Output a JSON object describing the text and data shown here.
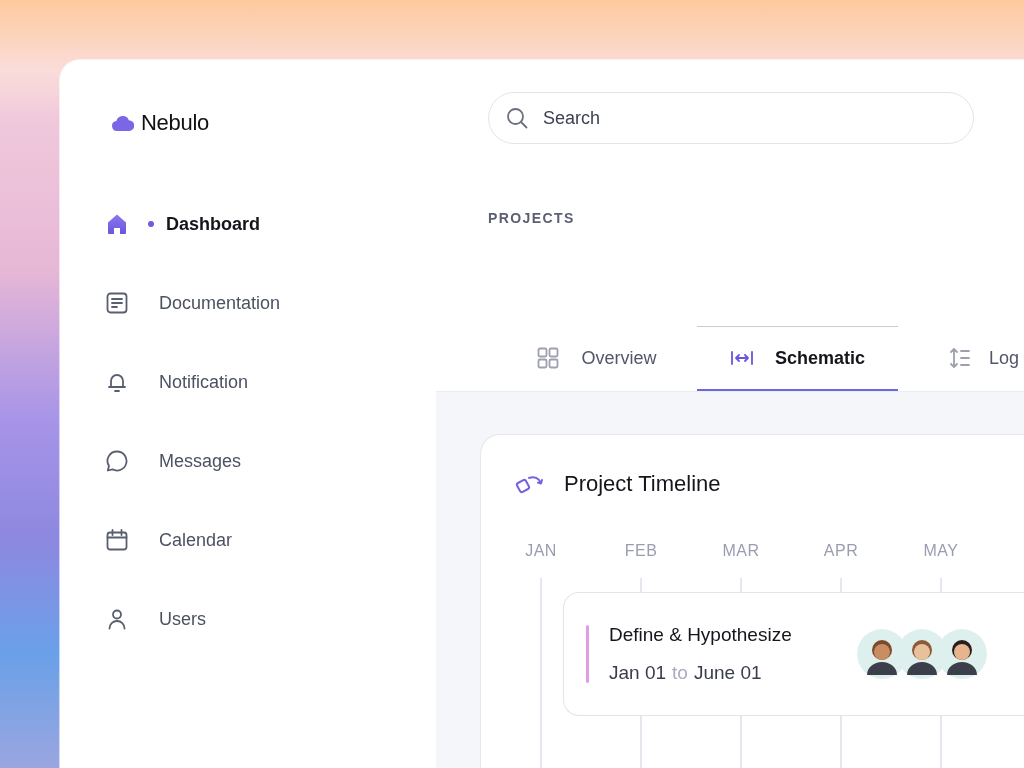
{
  "app": {
    "name": "Nebulo"
  },
  "sidebar": {
    "items": [
      {
        "label": "Dashboard",
        "kind": "home",
        "selected": true
      },
      {
        "label": "Documentation",
        "kind": "document",
        "selected": false
      },
      {
        "label": "Notification",
        "kind": "bell",
        "selected": false
      },
      {
        "label": "Messages",
        "kind": "chat",
        "selected": false
      },
      {
        "label": "Calendar",
        "kind": "calendar",
        "selected": false
      },
      {
        "label": "Users",
        "kind": "user",
        "selected": false
      }
    ]
  },
  "search": {
    "placeholder": "Search"
  },
  "section_label": "PROJECTS",
  "tabs": [
    {
      "label": "Overview",
      "kind": "grid",
      "selected": false
    },
    {
      "label": "Schematic",
      "kind": "span",
      "selected": true
    },
    {
      "label": "Log",
      "kind": "sort",
      "selected": false
    }
  ],
  "timeline": {
    "title": "Project Timeline",
    "months": [
      "JAN",
      "FEB",
      "MAR",
      "APR",
      "MAY"
    ],
    "tasks": [
      {
        "title": "Define & Hypothesize",
        "start": "Jan 01",
        "separator": "to",
        "end": "June 01",
        "color": "#e29ce6"
      }
    ]
  }
}
